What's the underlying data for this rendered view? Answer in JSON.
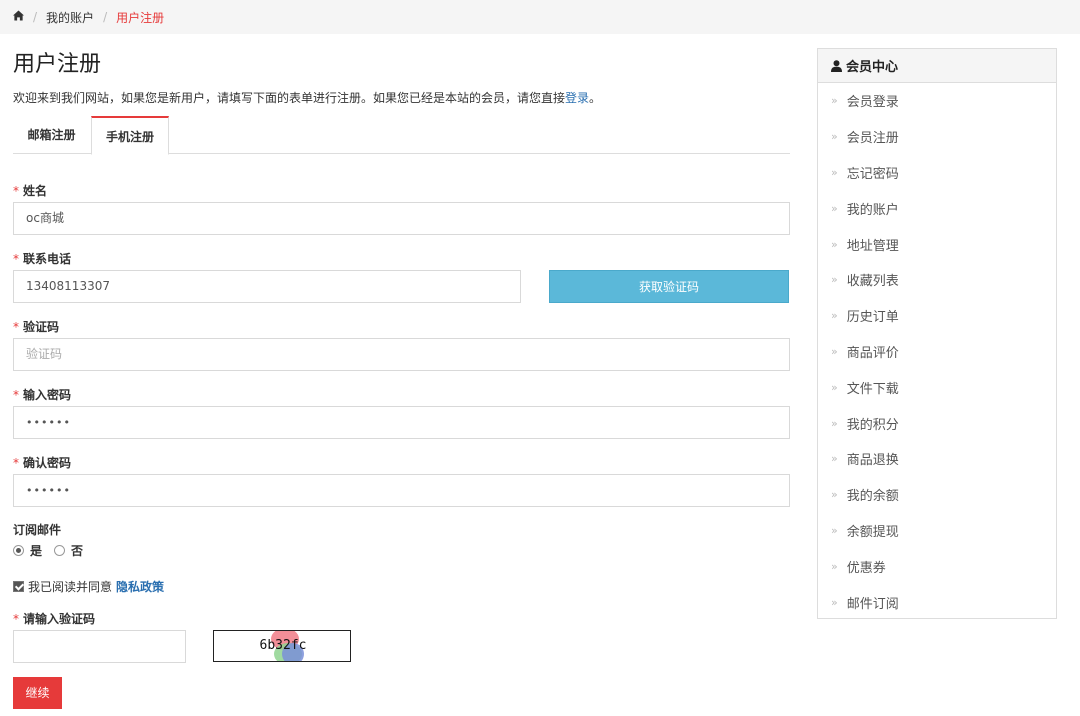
{
  "breadcrumb": {
    "home_icon": "home-icon",
    "items": [
      "我的账户",
      "用户注册"
    ]
  },
  "page": {
    "title": "用户注册",
    "intro_text": "欢迎来到我们网站，如果您是新用户，请填写下面的表单进行注册。如果您已经是本站的会员，请您直接",
    "intro_link": "登录",
    "intro_end": "。"
  },
  "tabs": [
    {
      "label": "邮箱注册",
      "active": false
    },
    {
      "label": "手机注册",
      "active": true
    }
  ],
  "form": {
    "required_mark": "*",
    "name": {
      "label": "姓名",
      "value": "oc商城"
    },
    "phone": {
      "label": "联系电话",
      "value": "13408113307"
    },
    "sms_button": "获取验证码",
    "code": {
      "label": "验证码",
      "placeholder": "验证码"
    },
    "password": {
      "label": "输入密码",
      "value": "••••••"
    },
    "confirm": {
      "label": "确认密码",
      "value": "••••••"
    },
    "newsletter": {
      "label": "订阅邮件",
      "yes": "是",
      "no": "否",
      "selected": "是"
    },
    "agree": {
      "text": "我已阅读并同意",
      "link": "隐私政策",
      "checked": true
    },
    "captcha": {
      "label": "请输入验证码",
      "image_text": "6b32fc"
    },
    "continue_button": "继续"
  },
  "sidebar": {
    "title": "会员中心",
    "icon": "user-icon",
    "items": [
      "会员登录",
      "会员注册",
      "忘记密码",
      "我的账户",
      "地址管理",
      "收藏列表",
      "历史订单",
      "商品评价",
      "文件下载",
      "我的积分",
      "商品退换",
      "我的余额",
      "余额提现",
      "优惠券",
      "邮件订阅"
    ]
  },
  "colors": {
    "accent": "#e63a3a",
    "link": "#2a6fb0",
    "sms_button": "#5bb8d9"
  }
}
